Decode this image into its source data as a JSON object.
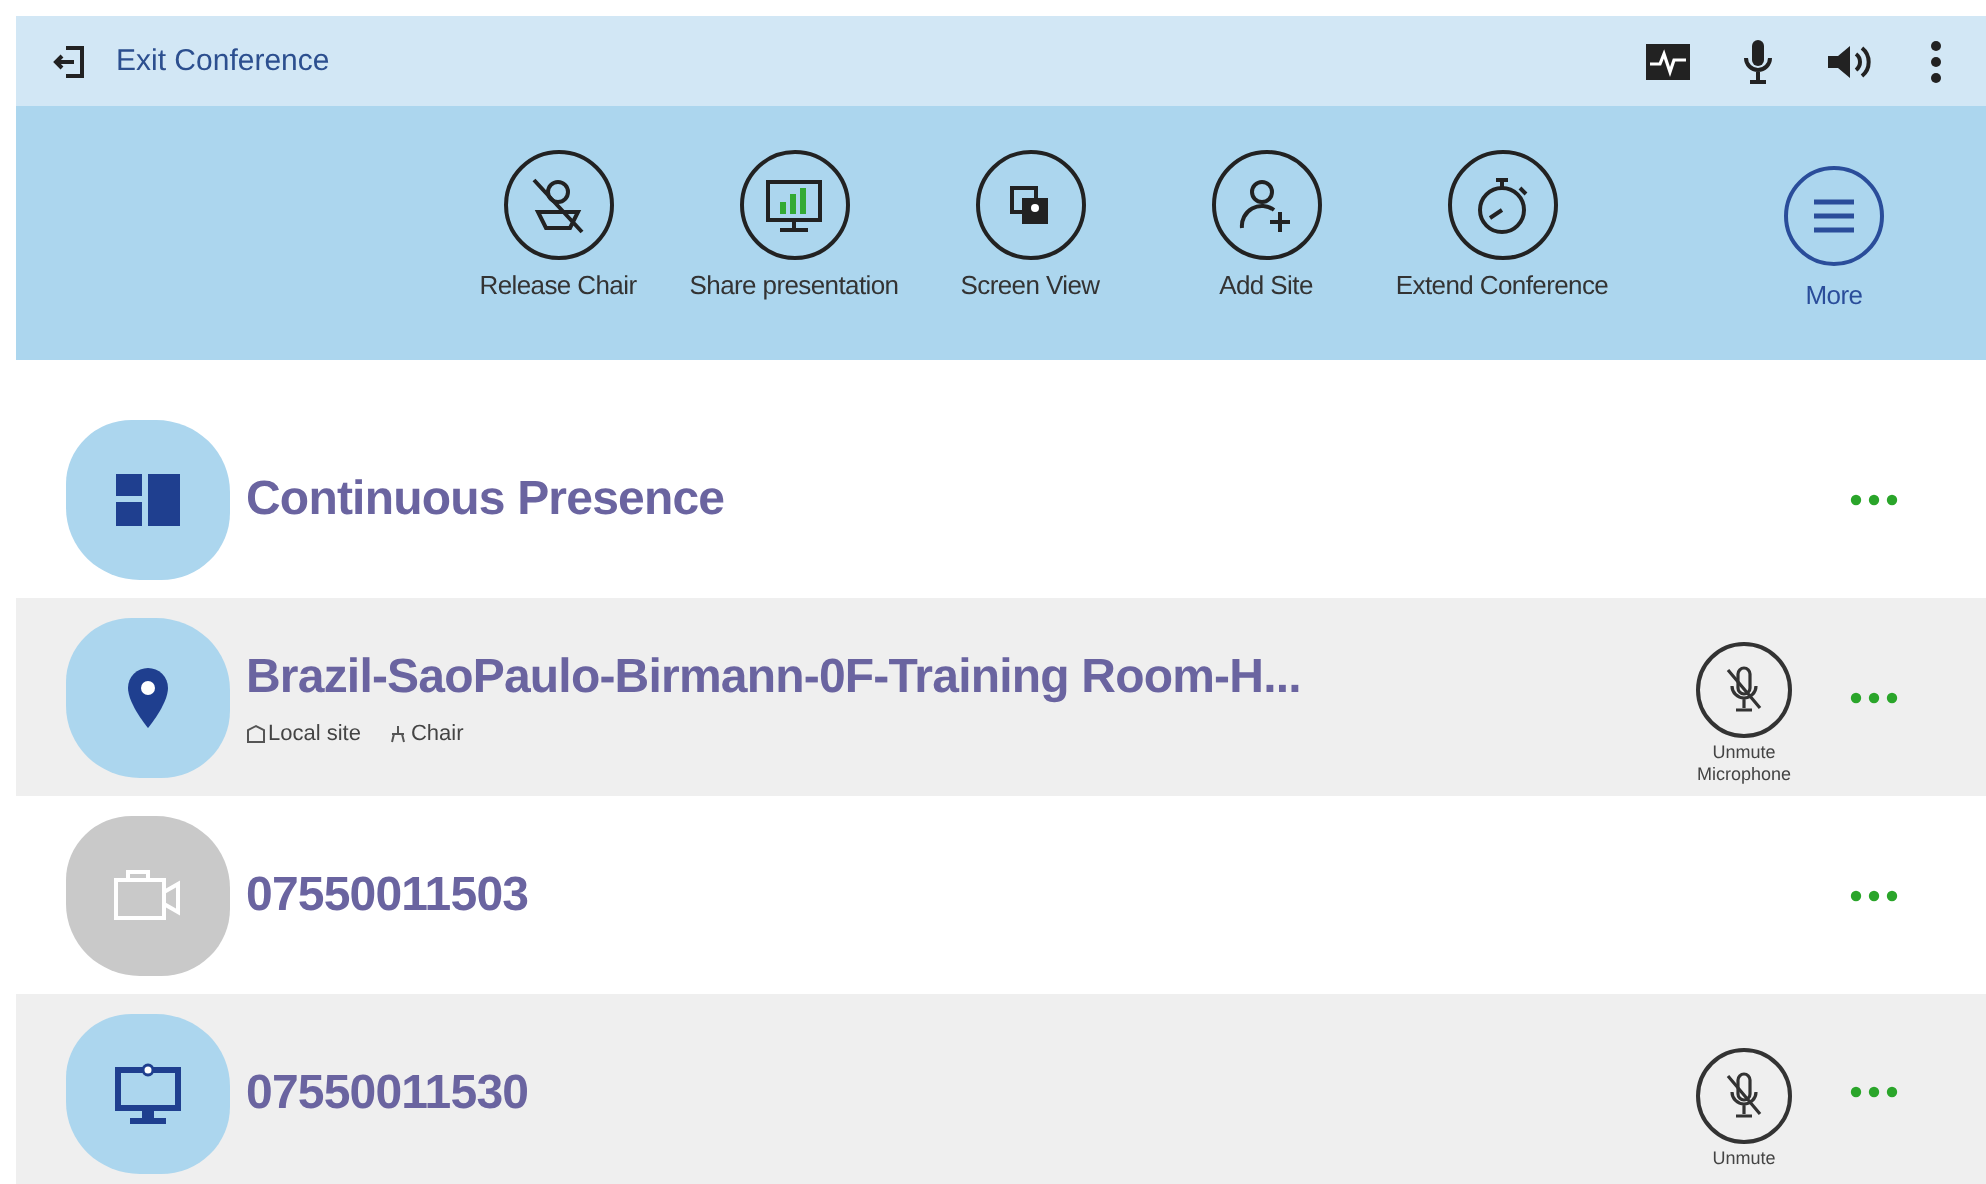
{
  "top_bar": {
    "exit_label": "Exit Conference",
    "icons": [
      {
        "kind": "signal"
      },
      {
        "kind": "mic"
      },
      {
        "kind": "speaker"
      },
      {
        "kind": "menu"
      }
    ]
  },
  "toolbar": [
    {
      "kind": "release",
      "label": "Release Chair"
    },
    {
      "kind": "share",
      "label": "Share presentation"
    },
    {
      "kind": "screen",
      "label": "Screen View"
    },
    {
      "kind": "add",
      "label": "Add Site"
    },
    {
      "kind": "extend",
      "label": "Extend Conference"
    },
    {
      "kind": "more",
      "label": "More"
    }
  ],
  "sites": [
    {
      "kind": "layout",
      "offline": false,
      "name": "Continuous Presence"
    },
    {
      "kind": "location",
      "offline": false,
      "name": "Brazil-SaoPaulo-Birmann-0F-Training Room-H...",
      "tags": [
        {
          "kind": "local",
          "label": "Local site"
        },
        {
          "kind": "chair",
          "label": "Chair"
        }
      ],
      "mic_label": "Unmute Microphone"
    },
    {
      "kind": "camera",
      "offline": true,
      "name": "07550011503"
    },
    {
      "kind": "monitor",
      "offline": false,
      "name": "07550011530",
      "mic_label": "Unmute"
    }
  ]
}
